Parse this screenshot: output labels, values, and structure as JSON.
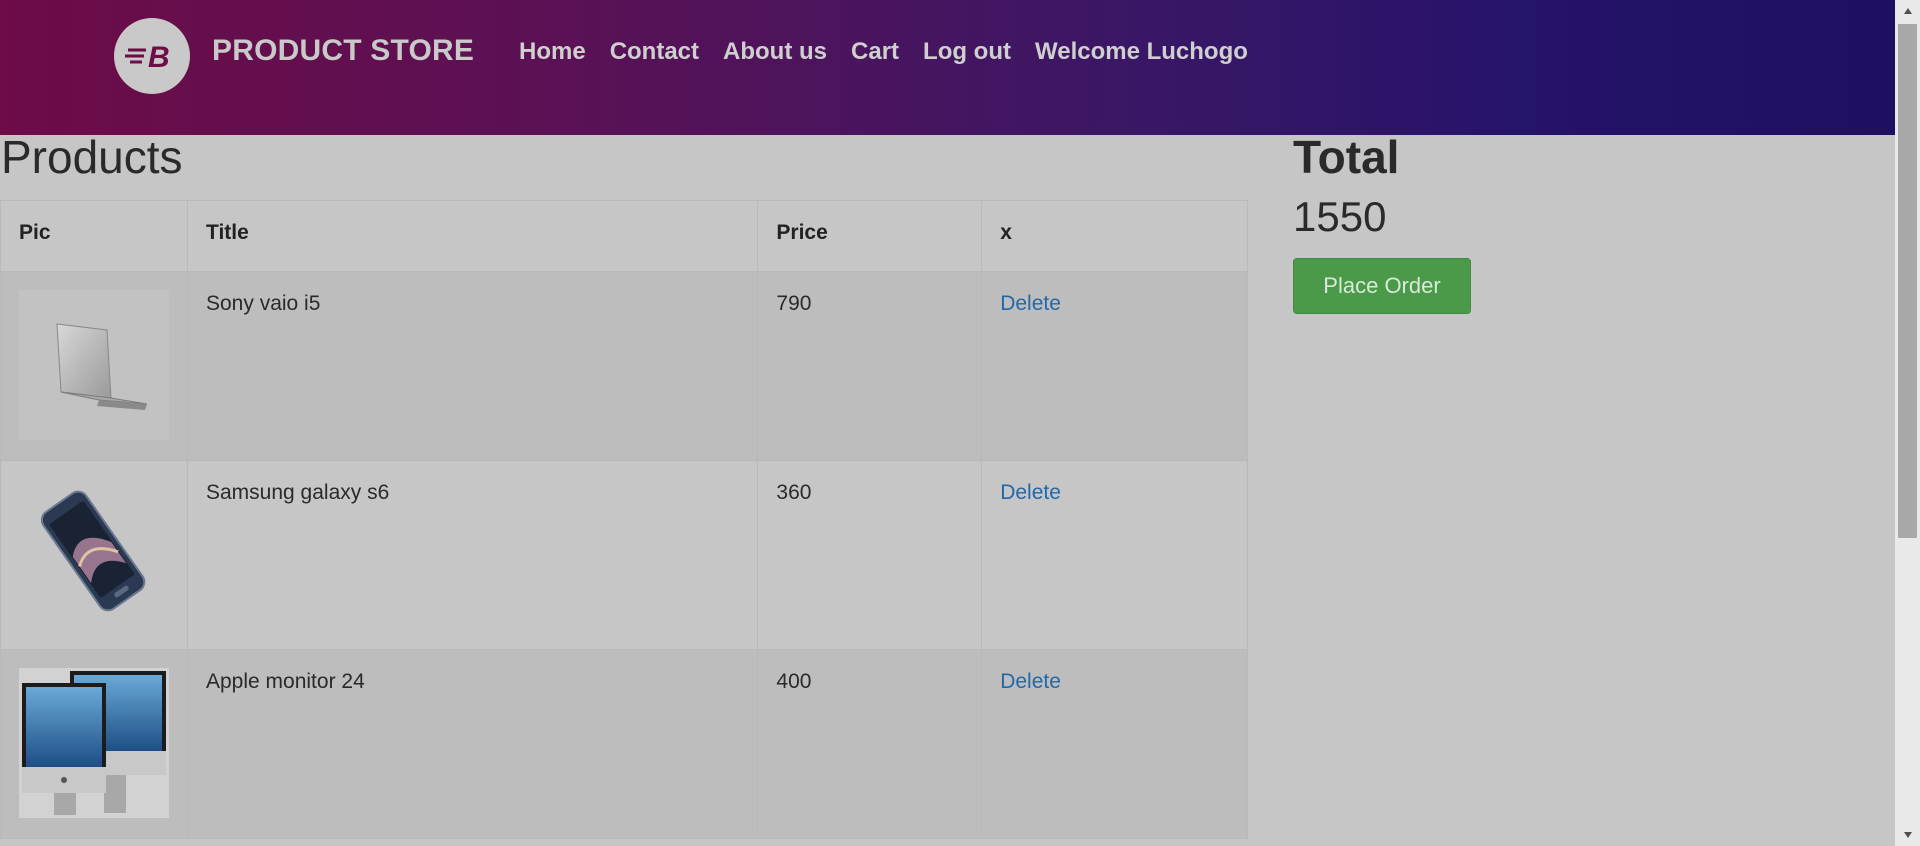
{
  "header": {
    "brand_name": "PRODUCT STORE",
    "logo_icon": "store-logo-icon",
    "nav": [
      "Home",
      "Contact",
      "About us",
      "Cart",
      "Log out",
      "Welcome Luchogo"
    ]
  },
  "products": {
    "heading": "Products",
    "columns": [
      "Pic",
      "Title",
      "Price",
      "x"
    ],
    "rows": [
      {
        "pic": "laptop-image",
        "title": "Sony vaio i5",
        "price": "790",
        "action": "Delete"
      },
      {
        "pic": "phone-image",
        "title": "Samsung galaxy s6",
        "price": "360",
        "action": "Delete"
      },
      {
        "pic": "monitor-image",
        "title": "Apple monitor 24",
        "price": "400",
        "action": "Delete"
      }
    ]
  },
  "total": {
    "heading": "Total",
    "value": "1550",
    "place_order_label": "Place Order"
  },
  "colors": {
    "header_start": "#6d0c47",
    "header_end": "#1f0f60",
    "page_bg": "#c6c6c6",
    "link": "#2468a8",
    "button": "#4a9a4a"
  }
}
